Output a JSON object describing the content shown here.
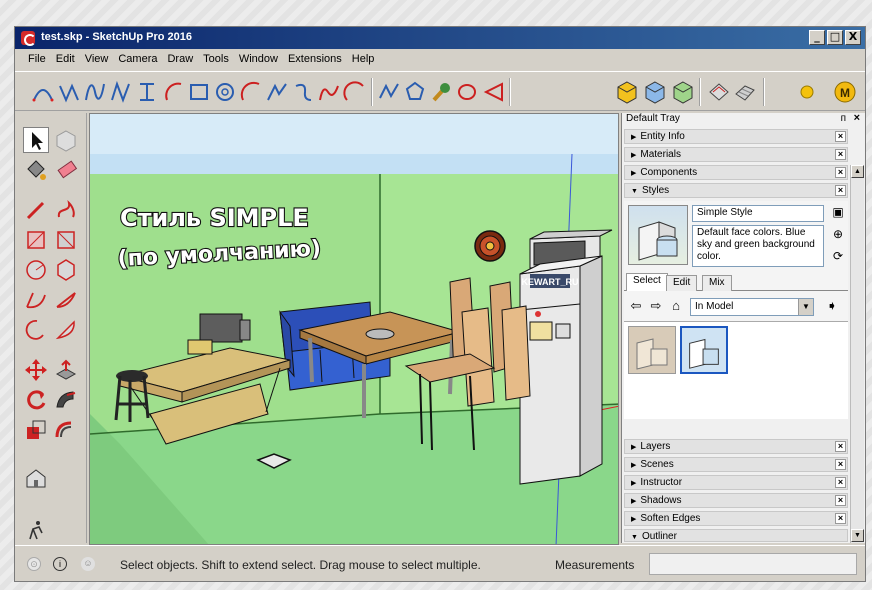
{
  "window": {
    "title": "test.skp - SketchUp Pro 2016",
    "buttons": {
      "minimize": "_",
      "maximize": "□",
      "close": "X"
    }
  },
  "menu": [
    "File",
    "Edit",
    "View",
    "Camera",
    "Draw",
    "Tools",
    "Window",
    "Extensions",
    "Help"
  ],
  "toolbar": {
    "icons": [
      "bezier-icon",
      "curve-icon",
      "spline-icon",
      "polyline-icon",
      "catmull-icon",
      "arc-icon",
      "rectangle-icon",
      "circle-icon",
      "arc2-icon",
      "spiral-icon",
      "freehand-icon",
      "sine-icon",
      "zigzag-icon",
      "polygon-icon",
      "wrench-icon",
      "ellipse-icon",
      "triangle-icon",
      "cube-yellow-icon",
      "cube-blue-icon",
      "cube-green-icon",
      "rotate-icon",
      "mesh-icon",
      "yellow-ball-icon",
      "m-badge-icon"
    ]
  },
  "left_tools": [
    "select-icon",
    "component-icon",
    "paint-bucket-icon",
    "eraser-icon",
    "line-icon",
    "freehand-icon",
    "rectangle-icon",
    "rotated-rect-icon",
    "circle-icon",
    "polygon-icon",
    "arc-icon",
    "arc2-icon",
    "arc3-icon",
    "pie-icon",
    "move-icon",
    "push-pull-icon",
    "rotate-icon",
    "follow-me-icon",
    "scale-icon",
    "offset-icon",
    "house-icon",
    "walk-icon"
  ],
  "viewport": {
    "overlay_line1": "Стиль SIMPLE",
    "overlay_line2": "(по умолчанию)",
    "fridge_label": "KEWART_RU",
    "colors": {
      "sky": "#bfe0f6",
      "wall": "#9ee08e",
      "floor": "#8fde8a",
      "ground_line": "#2f6b2c"
    }
  },
  "tray": {
    "title": "Default Tray",
    "pin": "ᴨ",
    "close": "×",
    "panels_top": [
      "Entity Info",
      "Materials",
      "Components"
    ],
    "styles_header": "Styles",
    "style_name": "Simple Style",
    "style_desc": "Default face colors. Blue sky and green background color.",
    "tabs": [
      "Select",
      "Edit",
      "Mix"
    ],
    "active_tab": "Select",
    "combo_value": "In Model",
    "panels_bottom": [
      "Layers",
      "Scenes",
      "Instructor",
      "Shadows",
      "Soften Edges",
      "Outliner"
    ]
  },
  "status": {
    "hint": "Select objects. Shift to extend select. Drag mouse to select multiple.",
    "measurements_label": "Measurements",
    "measurements_value": ""
  }
}
